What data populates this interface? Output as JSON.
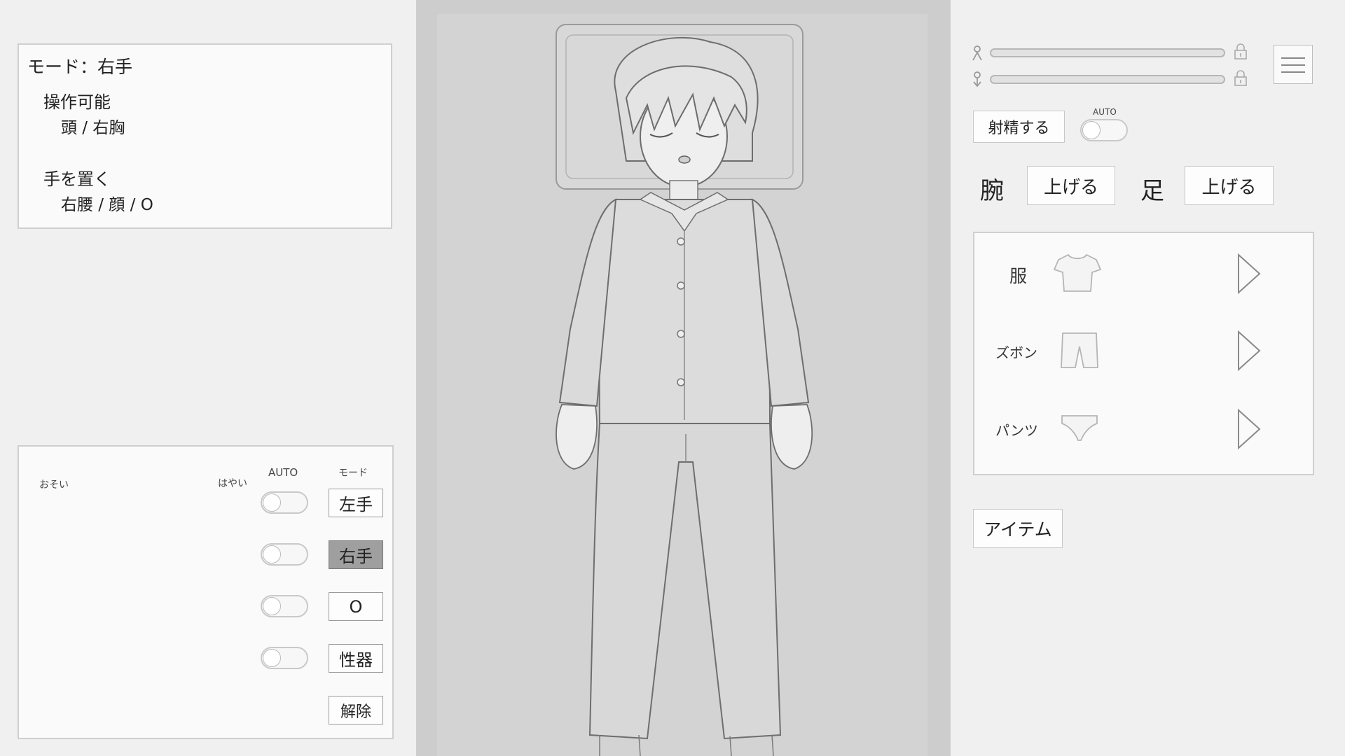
{
  "info_panel": {
    "title": "モード：右手",
    "operable_heading": "操作可能",
    "operable_value": "頭 / 右胸",
    "place_hand_heading": "手を置く",
    "place_hand_value": "右腰 / 顔 / O"
  },
  "control_panel": {
    "slow_label": "おそい",
    "fast_label": "はやい",
    "auto_header": "AUTO",
    "mode_header": "モード",
    "rows": [
      {
        "label": "左手",
        "auto": false,
        "active": false
      },
      {
        "label": "右手",
        "auto": false,
        "active": true
      },
      {
        "label": "O",
        "auto": false,
        "active": false
      },
      {
        "label": "性器",
        "auto": false,
        "active": false
      }
    ],
    "release_label": "解除"
  },
  "right_panel": {
    "ejaculate_label": "射精する",
    "auto_label": "AUTO",
    "auto_on": false,
    "arm_label": "腕",
    "arm_button": "上げる",
    "leg_label": "足",
    "leg_button": "上げる",
    "clothes": [
      {
        "label": "服",
        "icon": "shirt-icon"
      },
      {
        "label": "ズボン",
        "icon": "pants-icon"
      },
      {
        "label": "パンツ",
        "icon": "underwear-icon"
      }
    ],
    "item_label": "アイテム"
  },
  "colors": {
    "background": "#f0f0f0",
    "panel": "#fafafa",
    "active_mode": "#9f9f9f",
    "scene": "#cfcfcf"
  }
}
